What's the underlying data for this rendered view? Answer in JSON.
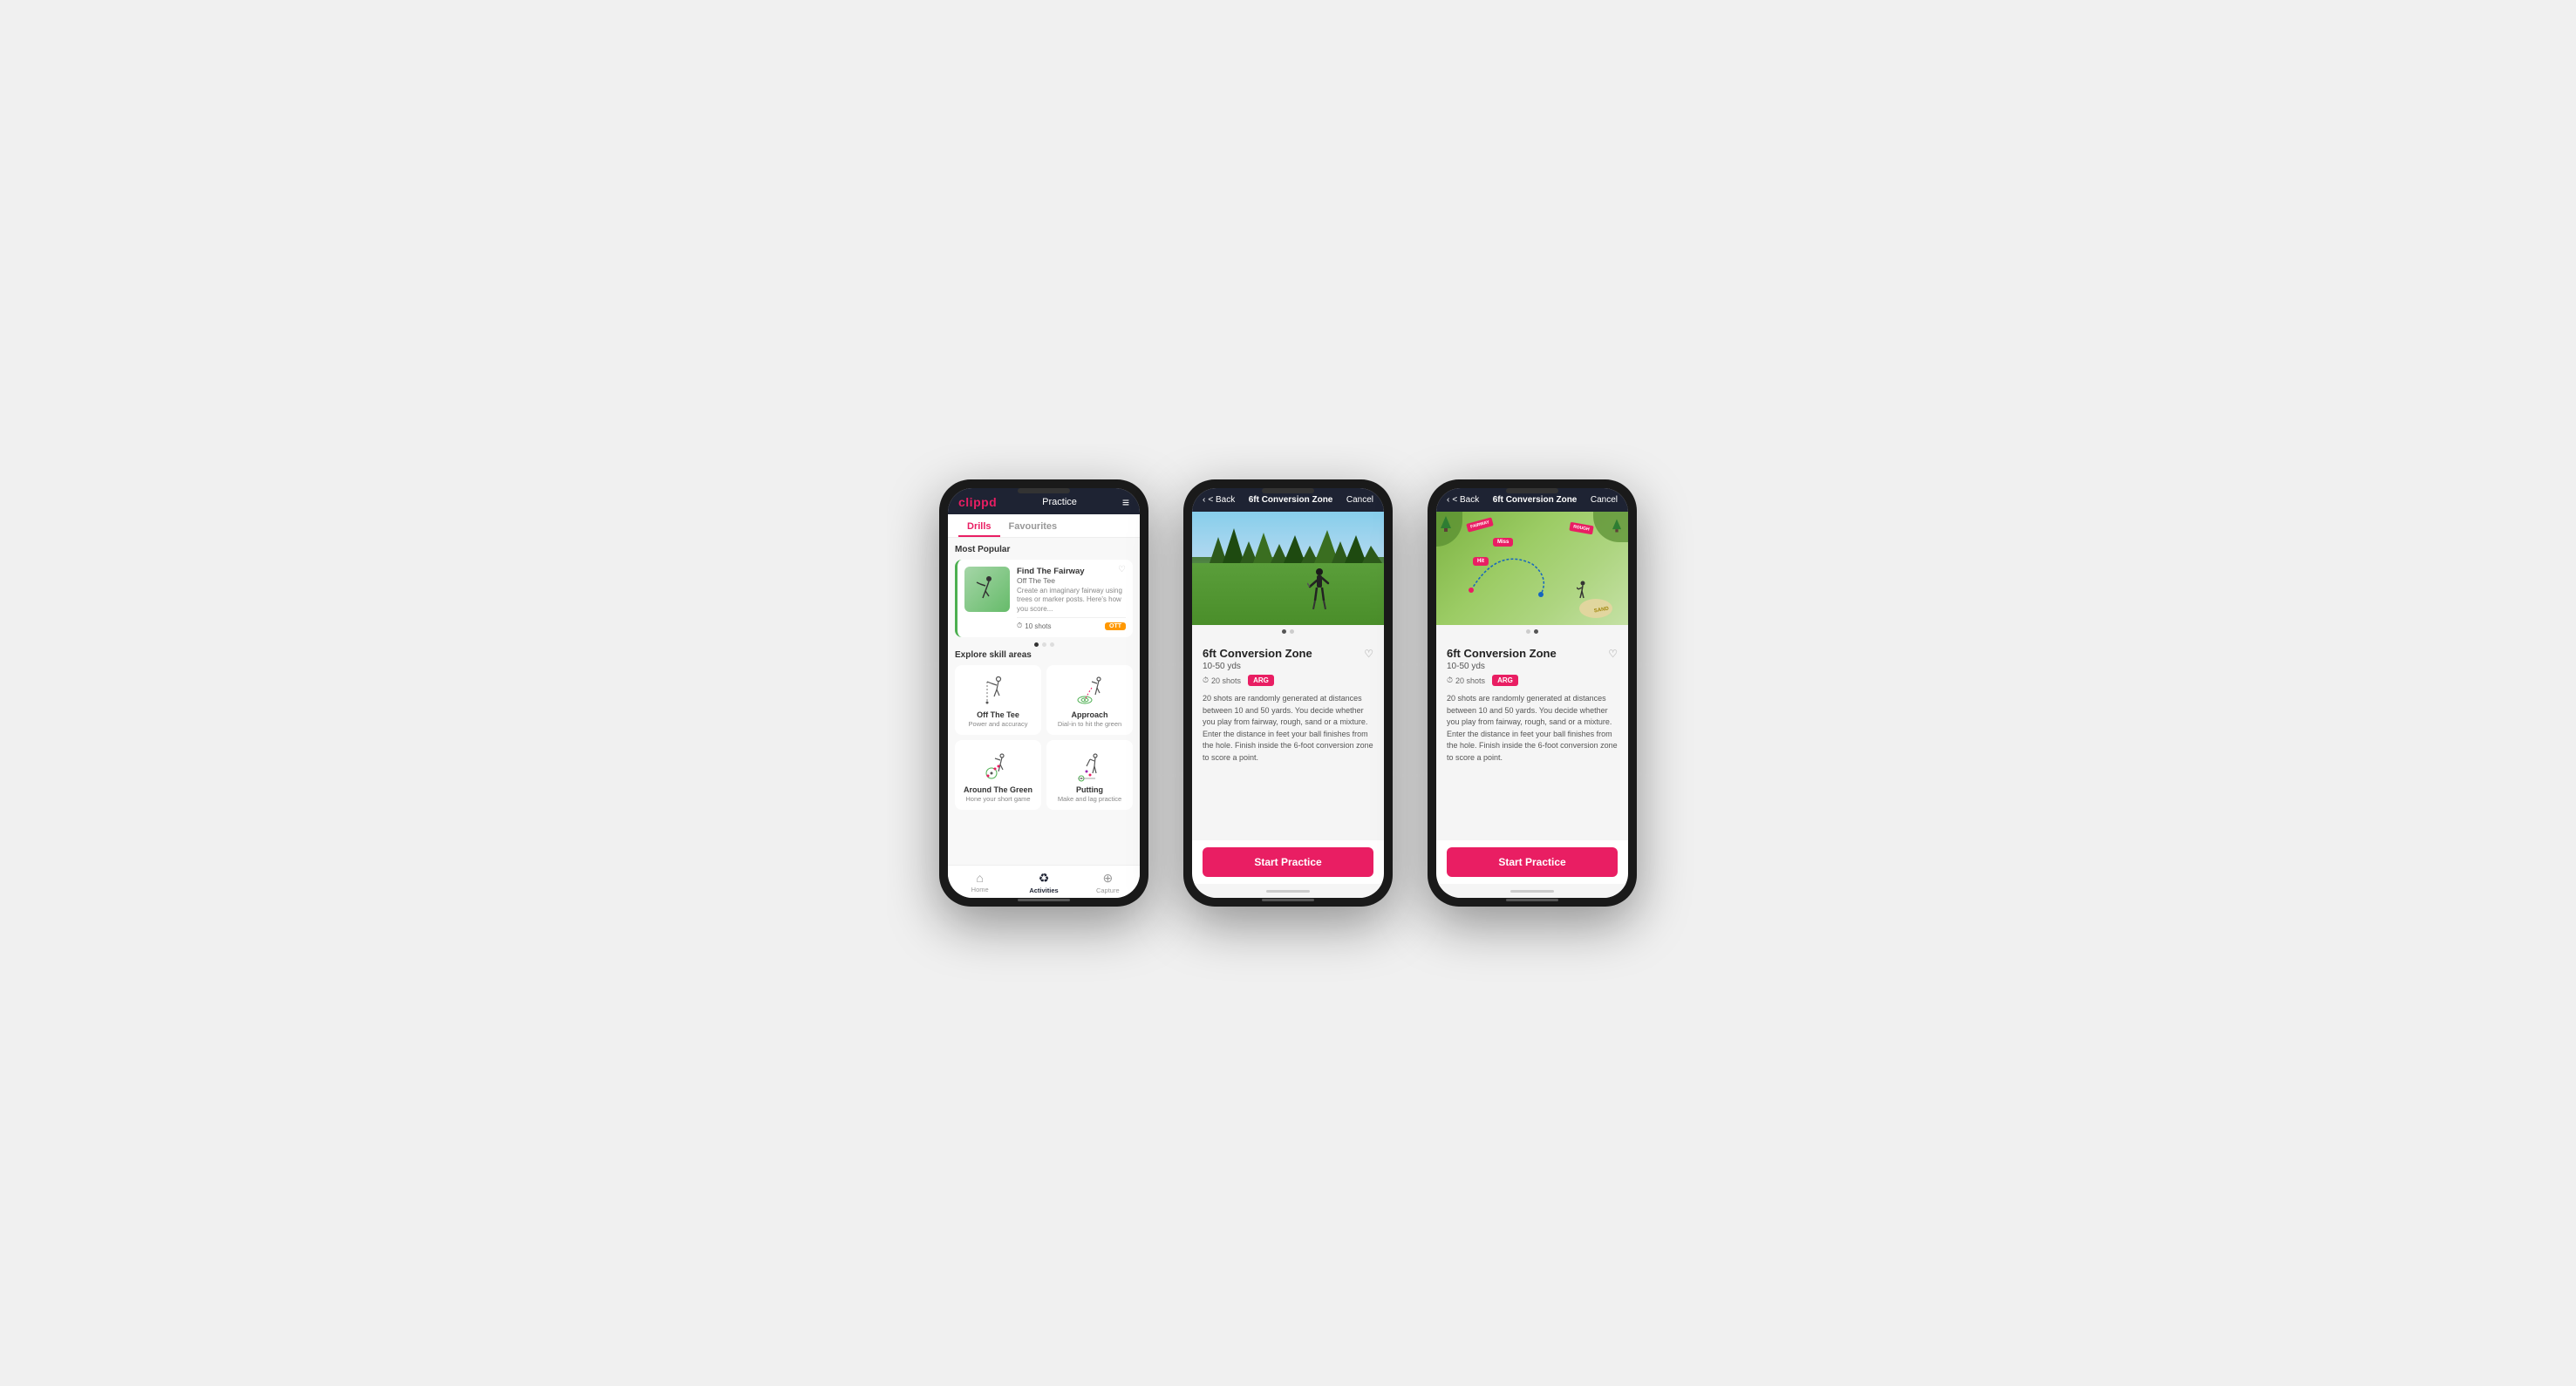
{
  "phone1": {
    "header": {
      "logo": "clippd",
      "title": "Practice",
      "menu_icon": "≡"
    },
    "tabs": [
      {
        "label": "Drills",
        "active": true
      },
      {
        "label": "Favourites",
        "active": false
      }
    ],
    "most_popular_title": "Most Popular",
    "featured_drill": {
      "title": "Find The Fairway",
      "subtitle": "Off The Tee",
      "description": "Create an imaginary fairway using trees or marker posts. Here's how you score...",
      "shots": "10 shots",
      "tag": "OTT"
    },
    "explore_title": "Explore skill areas",
    "skill_areas": [
      {
        "name": "Off The Tee",
        "desc": "Power and accuracy"
      },
      {
        "name": "Approach",
        "desc": "Dial-in to hit the green"
      },
      {
        "name": "Around The Green",
        "desc": "Hone your short game"
      },
      {
        "name": "Putting",
        "desc": "Make and lag practice"
      }
    ],
    "bottom_nav": [
      {
        "label": "Home",
        "icon": "⌂",
        "active": false
      },
      {
        "label": "Activities",
        "icon": "♻",
        "active": true
      },
      {
        "label": "Capture",
        "icon": "⊕",
        "active": false
      }
    ]
  },
  "phone2": {
    "header": {
      "back_label": "< Back",
      "title": "6ft Conversion Zone",
      "cancel_label": "Cancel"
    },
    "image_type": "photo",
    "drill_name": "6ft Conversion Zone",
    "yardage": "10-50 yds",
    "shots": "20 shots",
    "tag": "ARG",
    "description": "20 shots are randomly generated at distances between 10 and 50 yards. You decide whether you play from fairway, rough, sand or a mixture. Enter the distance in feet your ball finishes from the hole. Finish inside the 6-foot conversion zone to score a point.",
    "start_btn": "Start Practice"
  },
  "phone3": {
    "header": {
      "back_label": "< Back",
      "title": "6ft Conversion Zone",
      "cancel_label": "Cancel"
    },
    "image_type": "map",
    "drill_name": "6ft Conversion Zone",
    "yardage": "10-50 yds",
    "shots": "20 shots",
    "tag": "ARG",
    "description": "20 shots are randomly generated at distances between 10 and 50 yards. You decide whether you play from fairway, rough, sand or a mixture. Enter the distance in feet your ball finishes from the hole. Finish inside the 6-foot conversion zone to score a point.",
    "start_btn": "Start Practice"
  }
}
